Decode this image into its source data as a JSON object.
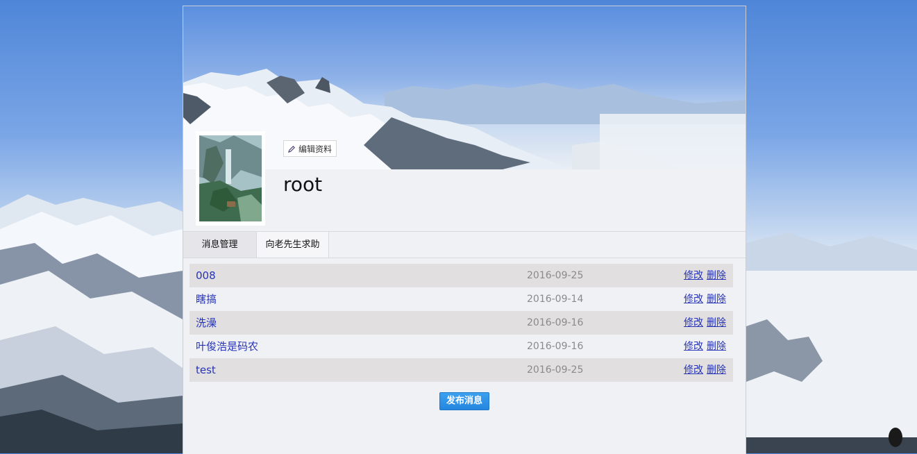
{
  "profile": {
    "edit_label": "编辑资料",
    "username": "root"
  },
  "tabs": [
    {
      "label": "消息管理"
    },
    {
      "label": "向老先生求助"
    }
  ],
  "messages": [
    {
      "title": "008",
      "date": "2016-09-25",
      "edit": "修改",
      "delete": "删除"
    },
    {
      "title": "瞎搞",
      "date": "2016-09-14",
      "edit": "修改",
      "delete": "删除"
    },
    {
      "title": "洗澡",
      "date": "2016-09-16",
      "edit": "修改",
      "delete": "删除"
    },
    {
      "title": "叶俊浩是码农",
      "date": "2016-09-16",
      "edit": "修改",
      "delete": "删除"
    },
    {
      "title": "test",
      "date": "2016-09-25",
      "edit": "修改",
      "delete": "删除"
    }
  ],
  "publish_label": "发布消息",
  "colors": {
    "link": "#2633b8",
    "accent_button": "#2486de",
    "row_stripe": "#e1dfe0"
  }
}
